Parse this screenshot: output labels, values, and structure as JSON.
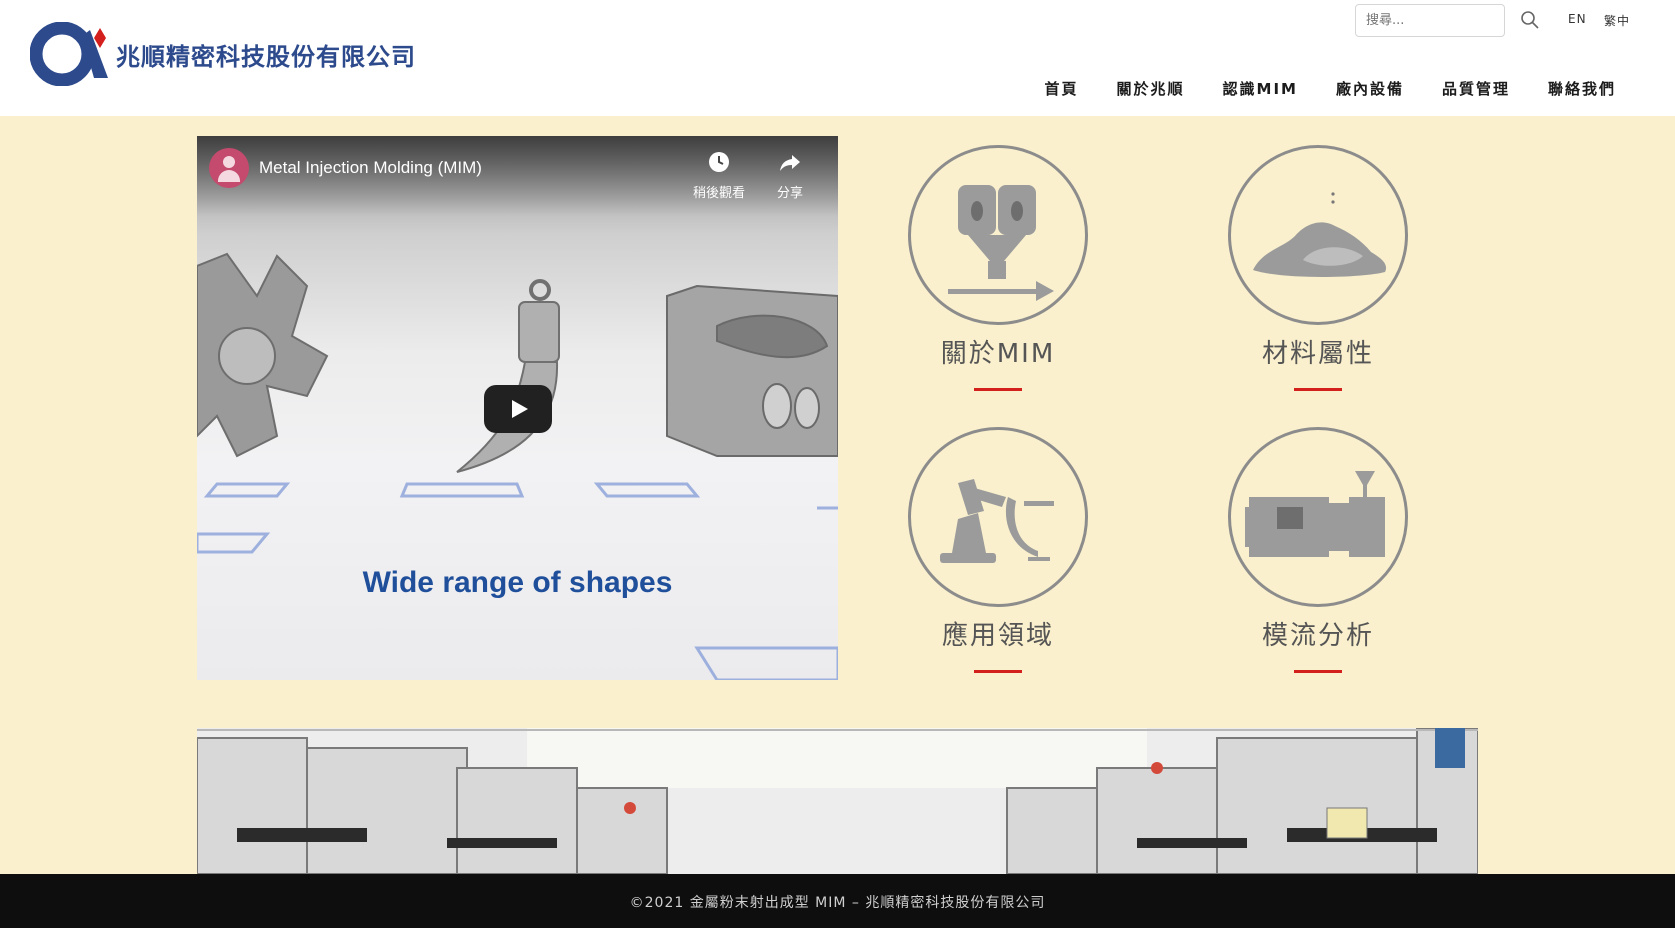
{
  "header": {
    "company_name": "兆順精密科技股份有限公司",
    "search": {
      "placeholder": "搜尋..."
    },
    "languages": [
      "EN",
      "繁中"
    ],
    "nav": [
      "首頁",
      "關於兆順",
      "認識MIM",
      "廠內設備",
      "品質管理",
      "聯絡我們"
    ]
  },
  "video": {
    "title": "Metal Injection Molding (MIM)",
    "watch_later": "稍後觀看",
    "share": "分享",
    "caption": "Wide range of shapes"
  },
  "tiles": [
    {
      "label": "關於MIM",
      "icon": "injection-machine-icon"
    },
    {
      "label": "材料屬性",
      "icon": "powder-pile-icon"
    },
    {
      "label": "應用領域",
      "icon": "robot-arm-icon"
    },
    {
      "label": "模流分析",
      "icon": "molding-machine-icon"
    }
  ],
  "footer": {
    "text": "©2021 金屬粉末射出成型 MIM – 兆順精密科技股份有限公司"
  },
  "colors": {
    "background": "#faf0cd",
    "accent": "#d4201c",
    "brand": "#2c4a8c",
    "footer": "#0e0e0e"
  }
}
